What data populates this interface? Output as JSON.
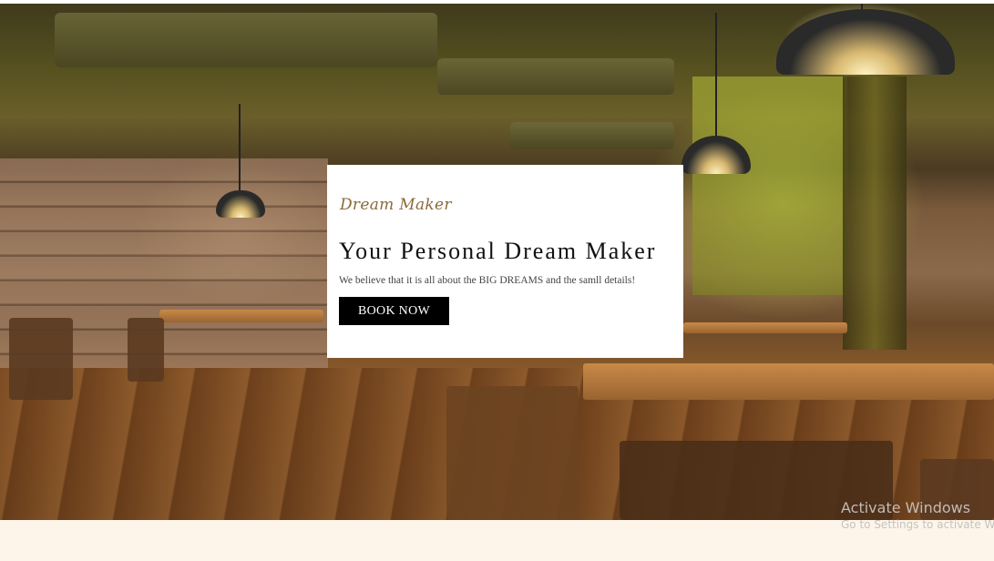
{
  "hero": {
    "brand": "Dream Maker",
    "headline": "Your Personal Dream Maker",
    "tagline": "We believe that it is all about the BIG DREAMS and the samll details!",
    "cta_label": "BOOK NOW"
  },
  "watermark": {
    "title": "Activate Windows",
    "subtitle": "Go to Settings to activate Windows."
  },
  "colors": {
    "page_background": "#fdf5e9",
    "card_background": "#ffffff",
    "button_background": "#000000",
    "brand_text": "#8a6a3a"
  }
}
